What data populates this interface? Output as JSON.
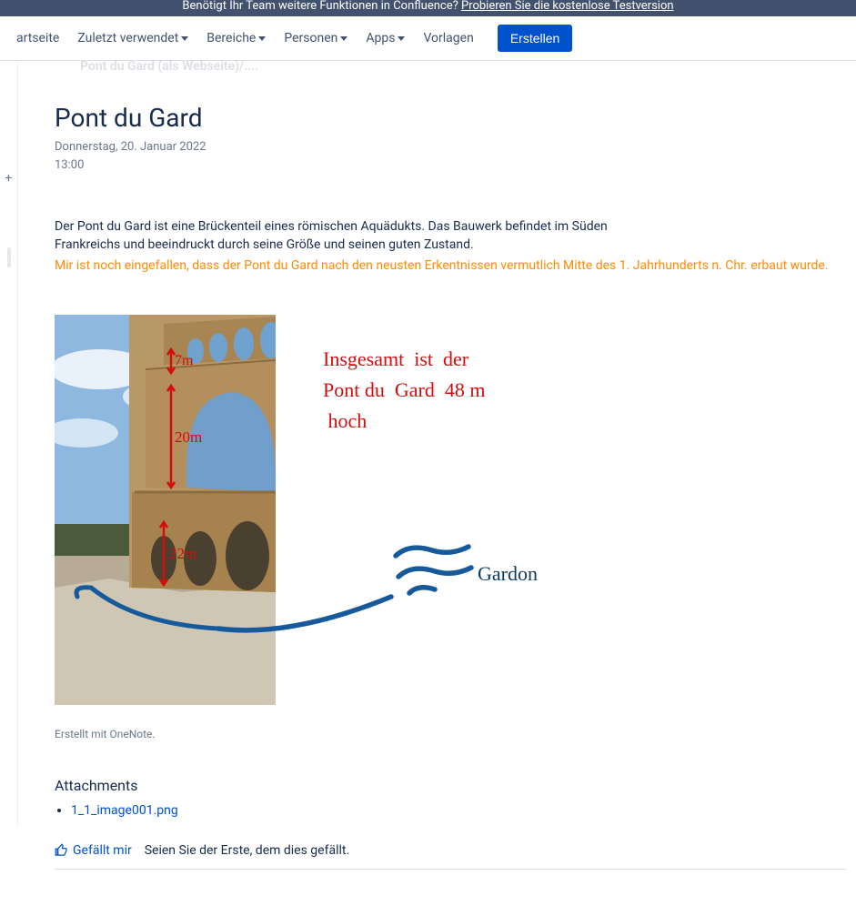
{
  "banner": {
    "text": "Benötigt Ihr Team weitere Funktionen in Confluence? ",
    "link_text": "Probieren Sie die kostenlose Testversion"
  },
  "nav": {
    "startseite": "artseite",
    "zuletzt": "Zuletzt verwendet",
    "bereiche": "Bereiche",
    "personen": "Personen",
    "apps": "Apps",
    "vorlagen": "Vorlagen",
    "create": "Erstellen"
  },
  "breadcrumb_stub": "Pont du Gard (als Webseite)/....",
  "page": {
    "title": "Pont du Gard",
    "date": "Donnerstag, 20. Januar 2022",
    "time": "13:00",
    "para1": "Der Pont du Gard ist eine Brückenteil eines römischen Aquädukts. Das Bauwerk befindet im Süden",
    "para2": "Frankreichs und beeindruckt durch seine Größe und seinen guten Zustand.",
    "highlight": "Mir ist noch eingefallen, dass der Pont du Gard nach den neusten Erkentnissen vermutlich Mitte des 1. Jahrhunderts n. Chr. erbaut wurde.",
    "caption": "Erstellt mit OneNote."
  },
  "handwriting": {
    "red_main": "Insgesamt  ist  der\nPont du  Gard  48 m\n hoch",
    "red_7m": "7m",
    "red_20m": "20m",
    "red_22m": "22m",
    "blue_river": "Gardon"
  },
  "attachments": {
    "header": "Attachments",
    "files": [
      "1_1_image001.png"
    ]
  },
  "like": {
    "action": "Gefällt mir",
    "status": "Seien Sie der Erste, dem dies gefällt."
  }
}
